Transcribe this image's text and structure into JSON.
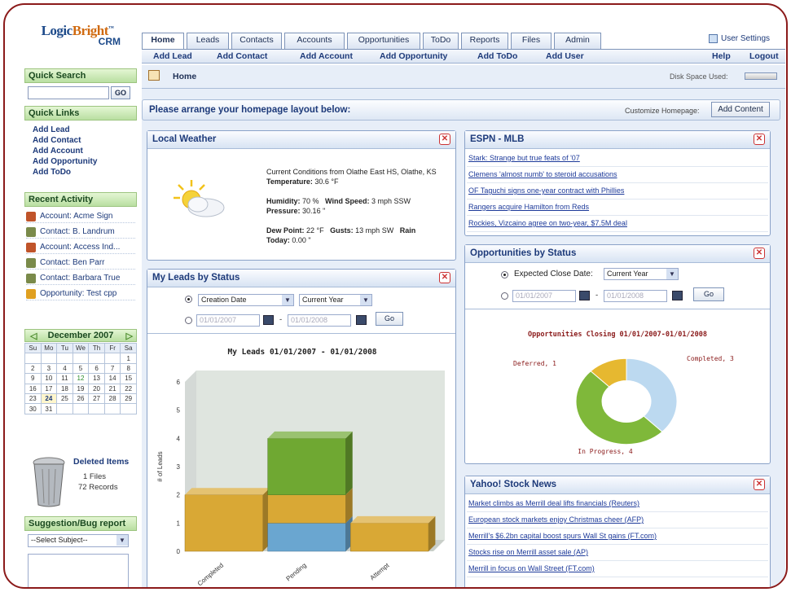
{
  "logo": {
    "part1": "Logic",
    "part2": "Bright",
    "tm": "™",
    "part3": "CRM"
  },
  "tabs": [
    "Home",
    "Leads",
    "Contacts",
    "Accounts",
    "Opportunities",
    "ToDo",
    "Reports",
    "Files",
    "Admin"
  ],
  "subnav": {
    "add_lead": "Add Lead",
    "add_contact": "Add Contact",
    "add_account": "Add Account",
    "add_opportunity": "Add Opportunity",
    "add_todo": "Add ToDo",
    "add_user": "Add User",
    "help": "Help",
    "logout": "Logout"
  },
  "user_settings": "User Settings",
  "quick_search": {
    "title": "Quick Search",
    "button": "GO",
    "value": ""
  },
  "quick_links": {
    "title": "Quick Links",
    "items": [
      "Add Lead",
      "Add Contact",
      "Add Account",
      "Add Opportunity",
      "Add ToDo"
    ]
  },
  "recent_activity": {
    "title": "Recent Activity",
    "items": [
      {
        "label": "Account: Acme Sign",
        "icon": "account-icon",
        "color": "#c0542a"
      },
      {
        "label": "Contact: B. Landrum",
        "icon": "contact-icon",
        "color": "#7a8a4a"
      },
      {
        "label": "Account: Access Ind...",
        "icon": "account-icon",
        "color": "#c0542a"
      },
      {
        "label": "Contact: Ben Parr",
        "icon": "contact-icon",
        "color": "#7a8a4a"
      },
      {
        "label": "Contact: Barbara True",
        "icon": "contact-icon",
        "color": "#7a8a4a"
      },
      {
        "label": "Opportunity: Test cpp",
        "icon": "opportunity-icon",
        "color": "#e0a020"
      }
    ]
  },
  "calendar": {
    "month": "December 2007",
    "prev": "◁",
    "next": "▷",
    "days": [
      "Su",
      "Mo",
      "Tu",
      "We",
      "Th",
      "Fr",
      "Sa"
    ],
    "weeks": [
      [
        "",
        "",
        "",
        "",
        "",
        "",
        "1"
      ],
      [
        "2",
        "3",
        "4",
        "5",
        "6",
        "7",
        "8"
      ],
      [
        "9",
        "10",
        "11",
        "12",
        "13",
        "14",
        "15"
      ],
      [
        "16",
        "17",
        "18",
        "19",
        "20",
        "21",
        "22"
      ],
      [
        "23",
        "24",
        "25",
        "26",
        "27",
        "28",
        "29"
      ],
      [
        "30",
        "31",
        "",
        "",
        "",
        "",
        ""
      ]
    ],
    "today": "24",
    "highlight": "12"
  },
  "deleted": {
    "title": "Deleted Items",
    "files": "1 Files",
    "records": "72 Records"
  },
  "suggestion": {
    "title": "Suggestion/Bug report",
    "select": "--Select Subject--"
  },
  "home": {
    "title": "Home",
    "disk_space": "Disk Space Used:"
  },
  "arrange": {
    "title": "Please arrange your homepage layout below:",
    "customize": "Customize Homepage:",
    "add_content": "Add Content"
  },
  "weather": {
    "title": "Local Weather",
    "conditions": "Current Conditions from Olathe East HS, Olathe, KS",
    "temperature_label": "Temperature:",
    "temperature": "30.6 °F",
    "humidity_label": "Humidity:",
    "humidity": "70 %",
    "wind_label": "Wind Speed:",
    "wind": "3 mph SSW",
    "pressure_label": "Pressure:",
    "pressure": "30.16 \"",
    "dew_label": "Dew Point:",
    "dew": "22 °F",
    "gusts_label": "Gusts:",
    "gusts": "13 mph SW",
    "rain_label": "Rain",
    "rain_today_label": "Today:",
    "rain_today": "0.00 \""
  },
  "espn": {
    "title": "ESPN - MLB",
    "items": [
      "Stark: Strange but true feats of '07",
      "Clemens 'almost numb' to steroid accusations",
      "OF Taguchi signs one-year contract with Phillies",
      "Rangers acquire Hamilton from Reds",
      "Rockies, Vizcaino agree on two-year, $7.5M deal"
    ]
  },
  "leads": {
    "title": "My Leads by Status",
    "date_type": "Creation Date",
    "period": "Current Year",
    "from": "01/01/2007",
    "to": "01/01/2008",
    "dash": "-",
    "go": "Go",
    "chart_title": "My Leads 01/01/2007 - 01/01/2008",
    "ylabel": "# of Leads"
  },
  "opportunities": {
    "title": "Opportunities by Status",
    "label": "Expected Close Date:",
    "period": "Current Year",
    "from": "01/01/2007",
    "to": "01/01/2008",
    "dash": "-",
    "go": "Go",
    "chart_title": "Opportunities Closing 01/01/2007-01/01/2008"
  },
  "yahoo": {
    "title": "Yahoo! Stock News",
    "items": [
      "Market climbs as Merrill deal lifts financials (Reuters)",
      "European stock markets enjoy Christmas cheer (AFP)",
      "Merrill's $6.2bn capital boost spurs Wall St gains (FT.com)",
      "Stocks rise on Merrill asset sale (AP)",
      "Merrill in focus on Wall Street (FT.com)"
    ]
  },
  "chart_data": [
    {
      "type": "bar",
      "title": "My Leads 01/01/2007 - 01/01/2008",
      "ylabel": "# of Leads",
      "xlabel": "",
      "ylim": [
        0,
        6
      ],
      "yticks": [
        0,
        1,
        2,
        3,
        4,
        5,
        6
      ],
      "categories": [
        "Completed",
        "Pending",
        "Attempt"
      ],
      "stacked": true,
      "series": [
        {
          "color": "#6aa6d0",
          "values": [
            0,
            1,
            0
          ]
        },
        {
          "color": "#d9a835",
          "values": [
            2,
            1,
            1
          ]
        },
        {
          "color": "#6fa832",
          "values": [
            0,
            2,
            0
          ]
        }
      ]
    },
    {
      "type": "pie",
      "donut": true,
      "title": "Opportunities Closing 01/01/2007-01/01/2008",
      "slices": [
        {
          "label": "Completed",
          "value": 3,
          "color": "#bcd9f0"
        },
        {
          "label": "In Progress",
          "value": 4,
          "color": "#7fb83a"
        },
        {
          "label": "Deferred",
          "value": 1,
          "color": "#e6b830"
        }
      ]
    }
  ]
}
